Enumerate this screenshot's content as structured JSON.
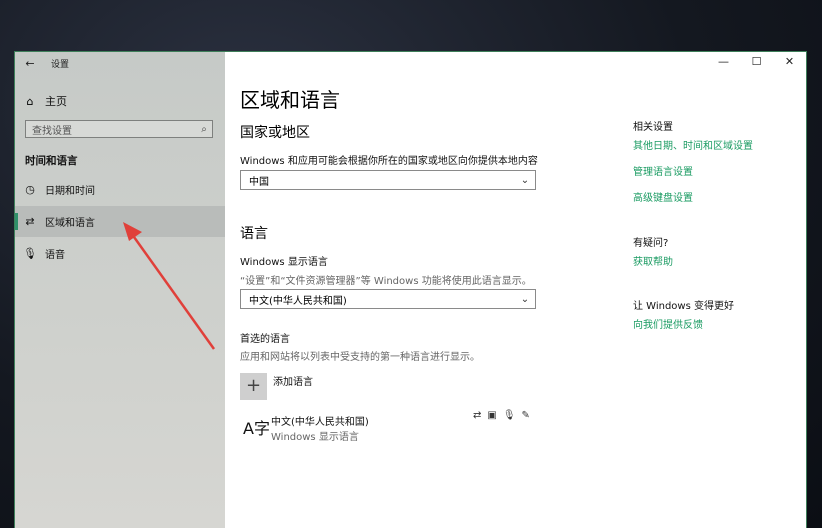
{
  "window": {
    "title": "设置",
    "back_icon": "back-arrow-icon",
    "controls": {
      "minimize": "—",
      "maximize": "☐",
      "close": "✕"
    }
  },
  "sidebar": {
    "home_label": "主页",
    "search_placeholder": "查找设置",
    "section": "时间和语言",
    "items": [
      {
        "label": "日期和时间",
        "icon": "calendar-clock-icon"
      },
      {
        "label": "区域和语言",
        "icon": "region-language-icon",
        "active": true
      },
      {
        "label": "语音",
        "icon": "microphone-icon"
      }
    ]
  },
  "main": {
    "title": "区域和语言",
    "country": {
      "heading": "国家或地区",
      "desc": "Windows 和应用可能会根据你所在的国家或地区向你提供本地内容",
      "value": "中国"
    },
    "language": {
      "heading": "语言",
      "display_heading": "Windows 显示语言",
      "display_desc": "“设置”和“文件资源管理器”等 Windows 功能将使用此语言显示。",
      "display_value": "中文(中华人民共和国)",
      "preferred_heading": "首选的语言",
      "preferred_desc": "应用和网站将以列表中受支持的第一种语言进行显示。",
      "add_label": "添加语言",
      "entry_name": "中文(中华人民共和国)",
      "entry_sub": "Windows 显示语言"
    }
  },
  "related": {
    "heading": "相关设置",
    "links": [
      "其他日期、时间和区域设置",
      "管理语言设置",
      "高级键盘设置"
    ],
    "question": "有疑问?",
    "help": "获取帮助",
    "better": "让 Windows 变得更好",
    "feedback": "向我们提供反馈"
  },
  "colors": {
    "accent": "#1a9b62",
    "arrow": "#e0403a"
  }
}
